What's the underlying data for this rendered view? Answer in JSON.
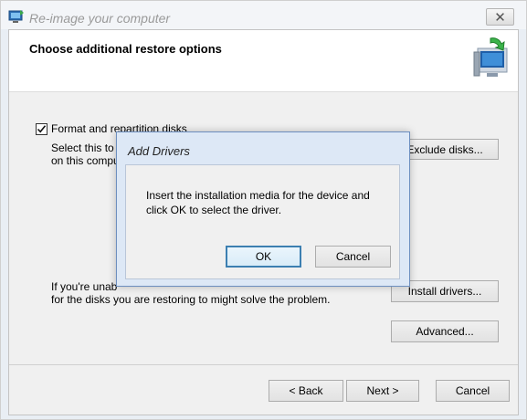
{
  "window": {
    "title": "Re-image your computer",
    "close_glyph": "✕"
  },
  "header": {
    "heading": "Choose additional restore options",
    "icon": "computer-restore-icon"
  },
  "format_option": {
    "label": "Format and repartition disks",
    "checked": true,
    "description_line1": "Select this to",
    "description_line2": "on this compu"
  },
  "buttons": {
    "exclude_disks": "Exclude disks...",
    "install_drivers": "Install drivers...",
    "advanced": "Advanced...",
    "back": "< Back",
    "next": "Next >",
    "cancel": "Cancel"
  },
  "hint": {
    "line1": "If you're unab",
    "line2": "for the disks you are restoring to might solve the problem."
  },
  "dialog": {
    "title": "Add Drivers",
    "message": "Insert the installation media for the device and click OK to select the driver.",
    "ok": "OK",
    "cancel": "Cancel"
  },
  "colors": {
    "accent": "#3c7fb1",
    "dialog_frame": "#dde8f6"
  }
}
